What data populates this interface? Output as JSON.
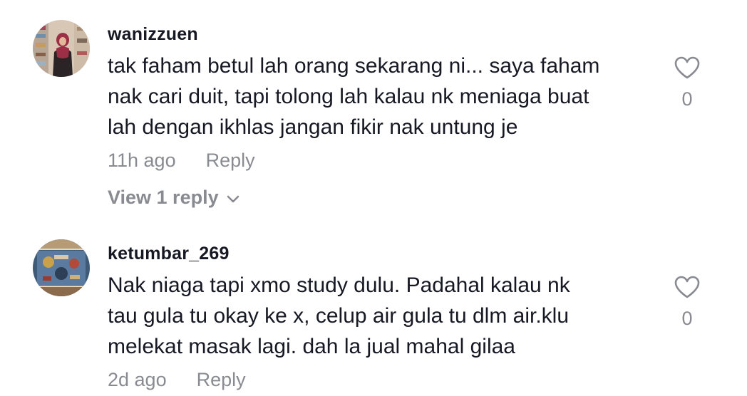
{
  "comments": [
    {
      "username": "wanizzuen",
      "lines": [
        "tak faham betul lah orang sekarang ni... saya faham",
        "nak cari duit, tapi tolong lah kalau nk meniaga buat",
        "lah dengan ikhlas jangan fikir nak untung je"
      ],
      "time": "11h ago",
      "reply_label": "Reply",
      "like_count": "0",
      "view_replies": "View 1 reply"
    },
    {
      "username": "ketumbar_269",
      "lines": [
        "Nak niaga tapi xmo study dulu. Padahal kalau nk",
        "tau gula tu okay ke x, celup air gula tu dlm air.klu",
        "melekat masak lagi. dah la jual mahal gilaa"
      ],
      "time": "2d ago",
      "reply_label": "Reply",
      "like_count": "0"
    }
  ],
  "icons": {
    "like": "heart-outline-icon",
    "expand": "chevron-down-icon"
  },
  "colors": {
    "primary_text": "#161823",
    "secondary_text": "#8a8b91"
  }
}
